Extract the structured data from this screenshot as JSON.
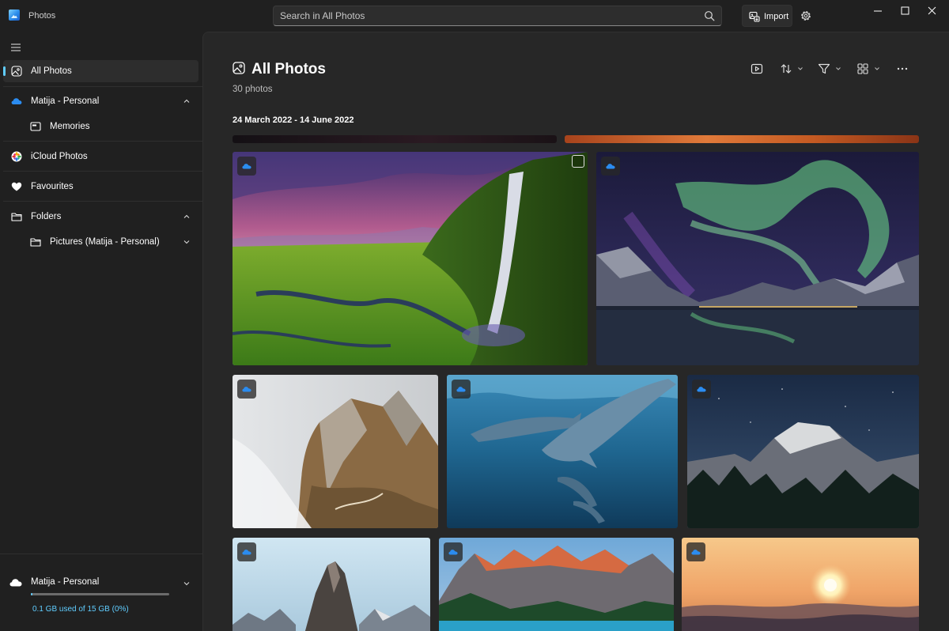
{
  "app": {
    "title": "Photos"
  },
  "search": {
    "placeholder": "Search in All Photos"
  },
  "toolbar": {
    "import_label": "Import"
  },
  "sidebar": {
    "items": [
      {
        "label": "All Photos"
      },
      {
        "label": "Matija - Personal"
      },
      {
        "label": "Memories"
      },
      {
        "label": "iCloud Photos"
      },
      {
        "label": "Favourites"
      },
      {
        "label": "Folders"
      },
      {
        "label": "Pictures (Matija - Personal)"
      }
    ],
    "account": {
      "name": "Matija - Personal",
      "storage_text": "0.1 GB used of 15 GB (0%)",
      "storage_fraction": 0.01
    }
  },
  "main": {
    "title": "All Photos",
    "count": "30 photos",
    "date_range": "24 March 2022 - 14 June 2022"
  },
  "colors": {
    "accent": "#60cdff",
    "onedrive": "#2b8cf0",
    "background": "#202020",
    "content_background": "#272727"
  },
  "icons": {
    "search": "search-icon",
    "import": "import-icon",
    "settings": "gear-icon",
    "menu": "hamburger-icon",
    "slideshow": "slideshow-icon",
    "sort": "sort-icon",
    "filter": "filter-icon",
    "view": "view-layout-icon",
    "more": "more-icon"
  },
  "photos": [
    {
      "subject": "waterfall",
      "cloud": true
    },
    {
      "subject": "aurora",
      "cloud": true
    },
    {
      "subject": "mountain-cliff-fog",
      "cloud": true
    },
    {
      "subject": "dolphins",
      "cloud": true
    },
    {
      "subject": "half-dome-night",
      "cloud": true
    },
    {
      "subject": "rock-spire",
      "cloud": true
    },
    {
      "subject": "lake-mountains",
      "cloud": true
    },
    {
      "subject": "sunset-sea",
      "cloud": true
    }
  ]
}
